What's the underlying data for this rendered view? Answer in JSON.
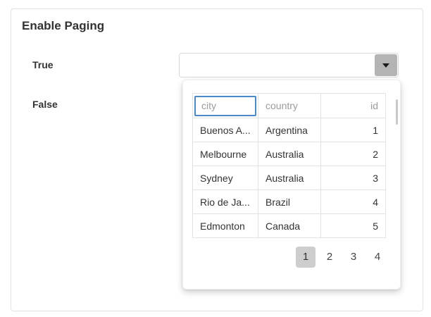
{
  "page": {
    "title": "Enable Paging"
  },
  "options": {
    "true_label": "True",
    "false_label": "False"
  },
  "combobox": {
    "value": "",
    "placeholder": ""
  },
  "grid": {
    "columns": [
      {
        "field": "city",
        "filter_placeholder": "city",
        "align": "left",
        "focused": true
      },
      {
        "field": "country",
        "filter_placeholder": "country",
        "align": "left",
        "focused": false
      },
      {
        "field": "id",
        "filter_placeholder": "id",
        "align": "right",
        "focused": false
      }
    ],
    "rows": [
      {
        "city": "Buenos A...",
        "country": "Argentina",
        "id": "1"
      },
      {
        "city": "Melbourne",
        "country": "Australia",
        "id": "2"
      },
      {
        "city": "Sydney",
        "country": "Australia",
        "id": "3"
      },
      {
        "city": "Rio de Ja...",
        "country": "Brazil",
        "id": "4"
      },
      {
        "city": "Edmonton",
        "country": "Canada",
        "id": "5"
      }
    ]
  },
  "pager": {
    "pages": [
      "1",
      "2",
      "3",
      "4"
    ],
    "current": "1"
  },
  "colors": {
    "accent_blue": "#4a89c8",
    "dropdown_button_gray": "#b4b4b4",
    "pager_selected_gray": "#cdcdcd",
    "border_gray": "#e2e2e2",
    "text_dark": "#333333",
    "placeholder_gray": "#9b9b9b"
  }
}
